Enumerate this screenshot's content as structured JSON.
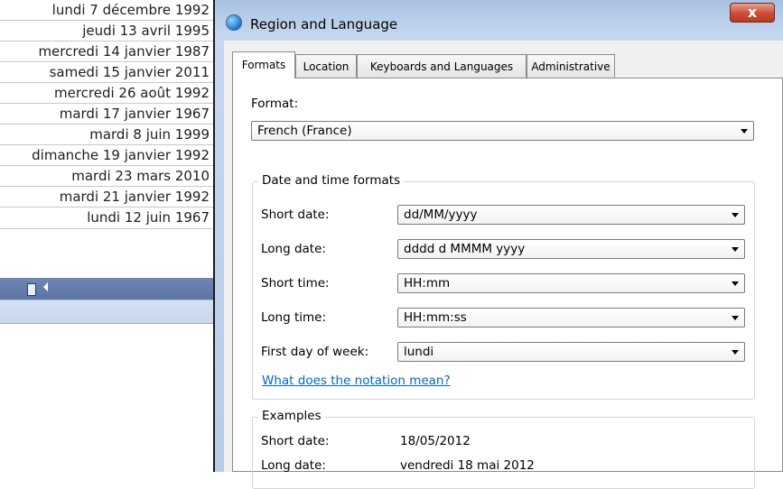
{
  "left_list": {
    "dates": [
      "lundi 7 décembre 1992",
      "jeudi 13 avril 1995",
      "mercredi 14 janvier 1987",
      "samedi 15 janvier 2011",
      "mercredi 26 août 1992",
      "mardi 17 janvier 1967",
      "mardi 8 juin 1999",
      "dimanche 19 janvier 1992",
      "mardi 23 mars 2010",
      "mardi 21 janvier 1992",
      "lundi 12 juin 1967"
    ]
  },
  "window": {
    "title": "Region and Language",
    "close_label": "x"
  },
  "tabs": [
    {
      "label": "Formats",
      "active": true
    },
    {
      "label": "Location",
      "active": false
    },
    {
      "label": "Keyboards and Languages",
      "active": false
    },
    {
      "label": "Administrative",
      "active": false
    }
  ],
  "formats": {
    "format_label": "Format:",
    "format_value": "French (France)",
    "date_time_group": "Date and time formats",
    "rows": [
      {
        "label": "Short date:",
        "value": "dd/MM/yyyy"
      },
      {
        "label": "Long date:",
        "value": "dddd d MMMM yyyy"
      },
      {
        "label": "Short time:",
        "value": "HH:mm"
      },
      {
        "label": "Long time:",
        "value": "HH:mm:ss"
      },
      {
        "label": "First day of week:",
        "value": "lundi"
      }
    ],
    "notation_link": "What does the notation mean?",
    "examples_group": "Examples",
    "examples": [
      {
        "label": "Short date:",
        "value": "18/05/2012"
      },
      {
        "label": "Long date:",
        "value": "vendredi 18 mai 2012"
      }
    ]
  },
  "icons": {
    "title_icon": "globe-icon",
    "close_icon": "close-icon",
    "dropdown_icon": "chevron-down-icon"
  }
}
